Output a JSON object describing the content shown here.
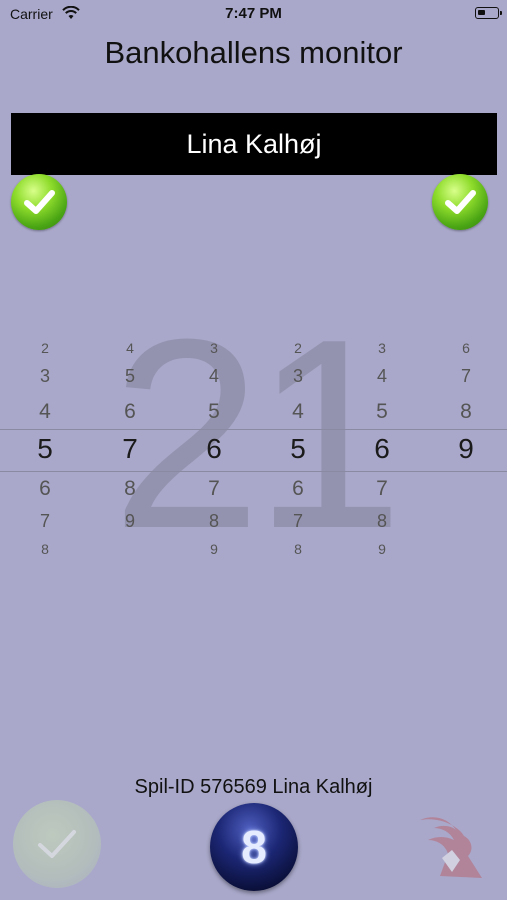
{
  "status_bar": {
    "carrier": "Carrier",
    "time": "7:47 PM"
  },
  "header": {
    "title": "Bankohallens monitor"
  },
  "banner": {
    "player_name": "Lina Kalhøj"
  },
  "current_number": "21",
  "picker": {
    "columns": [
      {
        "above": [
          "2",
          "3",
          "4"
        ],
        "selected": "5",
        "below": [
          "6",
          "7",
          "8"
        ]
      },
      {
        "above": [
          "4",
          "5",
          "6"
        ],
        "selected": "7",
        "below": [
          "8",
          "9"
        ]
      },
      {
        "above": [
          "3",
          "4",
          "5"
        ],
        "selected": "6",
        "below": [
          "7",
          "8",
          "9"
        ]
      },
      {
        "above": [
          "2",
          "3",
          "4"
        ],
        "selected": "5",
        "below": [
          "6",
          "7",
          "8"
        ]
      },
      {
        "above": [
          "3",
          "4",
          "5"
        ],
        "selected": "6",
        "below": [
          "7",
          "8",
          "9"
        ]
      },
      {
        "above": [
          "6",
          "7",
          "8"
        ],
        "selected": "9",
        "below": []
      }
    ]
  },
  "footer": {
    "spil_id": "Spil-ID 576569 Lina Kalhøj"
  },
  "ball": {
    "number": "8"
  },
  "colors": {
    "background": "#a9a8ca",
    "banner": "#000000",
    "check_green": "#6bc21e",
    "ball_blue": "#1c2775"
  },
  "icons": {
    "left_check": "check-circle-icon",
    "right_check": "check-circle-icon",
    "ghost_check": "check-icon",
    "logo": "bird-logo-icon"
  }
}
